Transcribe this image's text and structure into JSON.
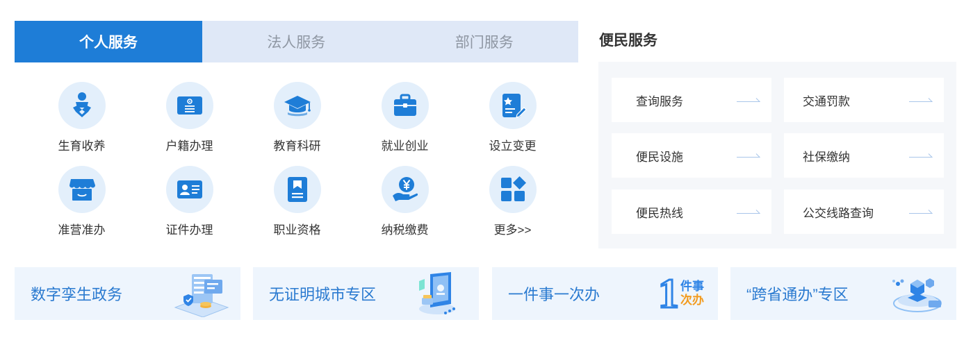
{
  "tabs": [
    {
      "label": "个人服务",
      "active": true
    },
    {
      "label": "法人服务",
      "active": false
    },
    {
      "label": "部门服务",
      "active": false
    }
  ],
  "services": [
    {
      "label": "生育收养",
      "icon": "baby-icon"
    },
    {
      "label": "户籍办理",
      "icon": "household-register-icon"
    },
    {
      "label": "教育科研",
      "icon": "graduation-cap-icon"
    },
    {
      "label": "就业创业",
      "icon": "briefcase-icon"
    },
    {
      "label": "设立变更",
      "icon": "certificate-edit-icon"
    },
    {
      "label": "准营准办",
      "icon": "storefront-icon"
    },
    {
      "label": "证件办理",
      "icon": "id-card-icon"
    },
    {
      "label": "职业资格",
      "icon": "bookmark-doc-icon"
    },
    {
      "label": "纳税缴费",
      "icon": "yuan-coin-hand-icon"
    },
    {
      "label": "更多>>",
      "icon": "more-apps-icon"
    }
  ],
  "convenience": {
    "title": "便民服务",
    "items": [
      {
        "label": "查询服务"
      },
      {
        "label": "交通罚款"
      },
      {
        "label": "便民设施"
      },
      {
        "label": "社保缴纳"
      },
      {
        "label": "便民热线"
      },
      {
        "label": "公交线路查询"
      }
    ]
  },
  "banners": [
    {
      "label": "数字孪生政务",
      "art": "digital-twin-illustration"
    },
    {
      "label": "无证明城市专区",
      "art": "proof-free-city-illustration"
    },
    {
      "label": "一件事一次办",
      "art": "one-thing-once-logo",
      "logo_big": "1",
      "logo_top": "件事",
      "logo_bottom": "次办"
    },
    {
      "label": "“跨省通办”专区",
      "art": "cross-province-illustration"
    }
  ],
  "colors": {
    "primary": "#1e7dd7",
    "tab_bg": "#dfe8f7",
    "icon_circle": "#e3effb",
    "banner_bg": "#eef5fd",
    "banner_text": "#2a7ad0",
    "accent_orange": "#f29b1f"
  }
}
